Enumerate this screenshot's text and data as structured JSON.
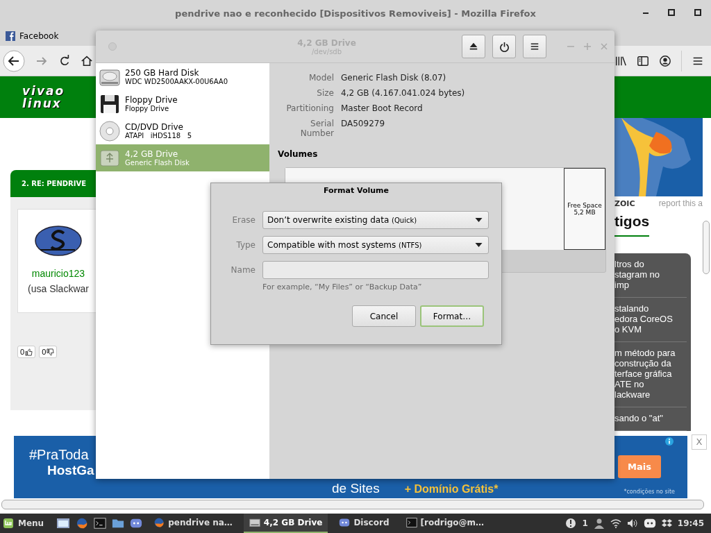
{
  "browser": {
    "title": "pendrive nao e reconhecido [Dispositivos Removiveis] - Mozilla Firefox",
    "bookmarks": [
      {
        "label": "Facebook"
      }
    ]
  },
  "webpage": {
    "logo": [
      "vivao",
      "linux"
    ],
    "post": {
      "heading": "2. RE: PENDRIVE",
      "user": "mauricio123",
      "distro": "(usa Slackwar",
      "likes": "0",
      "dislikes": "0"
    },
    "side": {
      "ad_brand": "ZOIC",
      "report": "report this a",
      "heading": "tigos",
      "articles": [
        {
          "lines": [
            "ltros do",
            "stagram no",
            "imp"
          ]
        },
        {
          "lines": [
            "stalando",
            "edora CoreOS",
            "o KVM"
          ]
        },
        {
          "lines": [
            "m método para",
            "construção da",
            "terface gráfica",
            "ATE no",
            "lackware"
          ]
        },
        {
          "lines": [
            "sando o \"at\""
          ]
        }
      ]
    },
    "ad": {
      "hashtag": "#PraToda",
      "brand": "HostGa",
      "slogan": "de Sites",
      "offer": "+ Domínio Grátis*",
      "note": "*condições no site",
      "cta": "Mais",
      "close": "X"
    }
  },
  "disks": {
    "title": "4,2 GB Drive",
    "subtitle": "/dev/sdb",
    "drives": [
      {
        "kind": "hdd",
        "name": "250 GB Hard Disk",
        "model": "WDC WD2500AAKX-00U6AA0",
        "selected": false
      },
      {
        "kind": "floppy",
        "name": "Floppy Drive",
        "model": "Floppy Drive",
        "selected": false
      },
      {
        "kind": "optical",
        "name": "CD/DVD Drive",
        "model": "ATAPI   iHDS118   5",
        "selected": false
      },
      {
        "kind": "usb",
        "name": "4,2 GB Drive",
        "model": "Generic Flash Disk",
        "selected": true
      }
    ],
    "details": [
      {
        "label": "Model",
        "value": "Generic Flash Disk (8.07)"
      },
      {
        "label": "Size",
        "value": "4,2 GB (4.167.041.024 bytes)"
      },
      {
        "label": "Partitioning",
        "value": "Master Boot Record"
      },
      {
        "label": "Serial Number",
        "value": "DA509279"
      }
    ],
    "volumes_heading": "Volumes",
    "free_space": [
      "Free Space",
      "5,2 MB"
    ]
  },
  "dialog": {
    "title": "Format Volume",
    "fields": [
      {
        "kind": "select",
        "label": "Erase",
        "value": "Don’t overwrite existing data",
        "note": "(Quick)"
      },
      {
        "kind": "select",
        "label": "Type",
        "value": "Compatible with most systems",
        "note": "(NTFS)"
      },
      {
        "kind": "text",
        "label": "Name",
        "hint": "For example, “My Files” or “Backup Data”"
      }
    ],
    "buttons": [
      {
        "label": "Cancel",
        "suggested": false
      },
      {
        "label": "Format…",
        "suggested": true
      }
    ]
  },
  "taskbar": {
    "menu": "Menu",
    "tasks": [
      {
        "kind": "firefox",
        "label": "pendrive na…",
        "selected": false
      },
      {
        "kind": "disks",
        "label": "4,2 GB Drive",
        "selected": true
      },
      {
        "kind": "discord",
        "label": "Discord",
        "selected": false
      },
      {
        "kind": "terminal",
        "label": "[rodrigo@m…",
        "selected": false
      }
    ],
    "notification_count": "1",
    "clock": "19:45"
  }
}
